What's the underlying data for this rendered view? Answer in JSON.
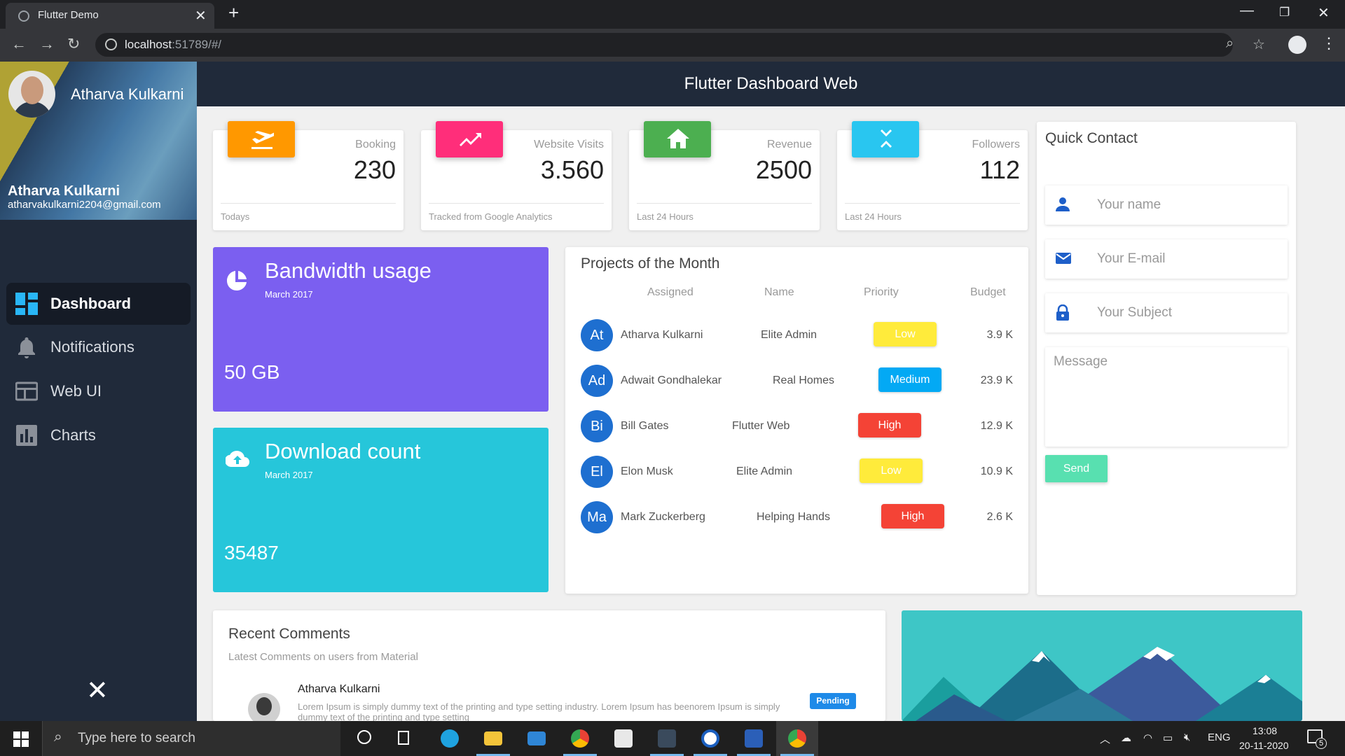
{
  "browser": {
    "tab_title": "Flutter Demo",
    "url_host": "localhost",
    "url_rest": ":51789/#/"
  },
  "sidebar": {
    "header_name": "Atharva Kulkarni",
    "account_name": "Atharva Kulkarni",
    "account_email": "atharvakulkarni2204@gmail.com",
    "items": [
      {
        "label": "Dashboard",
        "icon": "dashboard-icon",
        "active": true
      },
      {
        "label": "Notifications",
        "icon": "bell-icon",
        "active": false
      },
      {
        "label": "Web UI",
        "icon": "web-icon",
        "active": false
      },
      {
        "label": "Charts",
        "icon": "chart-icon",
        "active": false
      }
    ]
  },
  "app_bar": {
    "title": "Flutter Dashboard Web"
  },
  "stats": [
    {
      "label": "Booking",
      "value": "230",
      "footer": "Todays",
      "color": "#ff9800",
      "icon": "flight-takeoff-icon"
    },
    {
      "label": "Website Visits",
      "value": "3.560",
      "footer": "Tracked from Google Analytics",
      "color": "#ff2e7a",
      "icon": "trending-up-icon"
    },
    {
      "label": "Revenue",
      "value": "2500",
      "footer": "Last 24 Hours",
      "color": "#4caf50",
      "icon": "home-icon"
    },
    {
      "label": "Followers",
      "value": "112",
      "footer": "Last 24 Hours",
      "color": "#29c6f0",
      "icon": "expand-icon"
    }
  ],
  "bandwidth": {
    "title": "Bandwidth usage",
    "subtitle": "March 2017",
    "value": "50 GB",
    "color": "#7b5ff0"
  },
  "downloads": {
    "title": "Download count",
    "subtitle": "March 2017",
    "value": "35487",
    "color": "#26c6da"
  },
  "projects": {
    "title": "Projects of the Month",
    "columns": [
      "Assigned",
      "Name",
      "Priority",
      "Budget"
    ],
    "rows": [
      {
        "initials": "At",
        "person": "Atharva Kulkarni",
        "name": "Elite Admin",
        "priority": "Low",
        "budget": "3.9 K"
      },
      {
        "initials": "Ad",
        "person": "Adwait Gondhalekar",
        "name": "Real Homes",
        "priority": "Medium",
        "budget": "23.9 K"
      },
      {
        "initials": "Bi",
        "person": "Bill Gates",
        "name": "Flutter Web",
        "priority": "High",
        "budget": "12.9 K"
      },
      {
        "initials": "El",
        "person": "Elon Musk",
        "name": "Elite Admin",
        "priority": "Low",
        "budget": "10.9 K"
      },
      {
        "initials": "Ma",
        "person": "Mark Zuckerberg",
        "name": "Helping Hands",
        "priority": "High",
        "budget": "2.6 K"
      }
    ],
    "priority_colors": {
      "Low": "#ffeb3b",
      "Medium": "#03a9f4",
      "High": "#f44336"
    }
  },
  "contact": {
    "title": "Quick Contact",
    "name_placeholder": "Your name",
    "email_placeholder": "Your E-mail",
    "subject_placeholder": "Your Subject",
    "message_placeholder": "Message",
    "send_label": "Send"
  },
  "comments": {
    "title": "Recent Comments",
    "subtitle": "Latest Comments on users from Material",
    "items": [
      {
        "author": "Atharva Kulkarni",
        "text": "Lorem Ipsum is simply dummy text of the printing and type setting industry. Lorem Ipsum has beenorem Ipsum is simply dummy text of the printing and type setting",
        "status": "Pending"
      }
    ]
  },
  "taskbar": {
    "search_placeholder": "Type here to search",
    "tray_lang": "ENG",
    "time": "13:08",
    "date": "20-11-2020",
    "notification_count": "5"
  }
}
